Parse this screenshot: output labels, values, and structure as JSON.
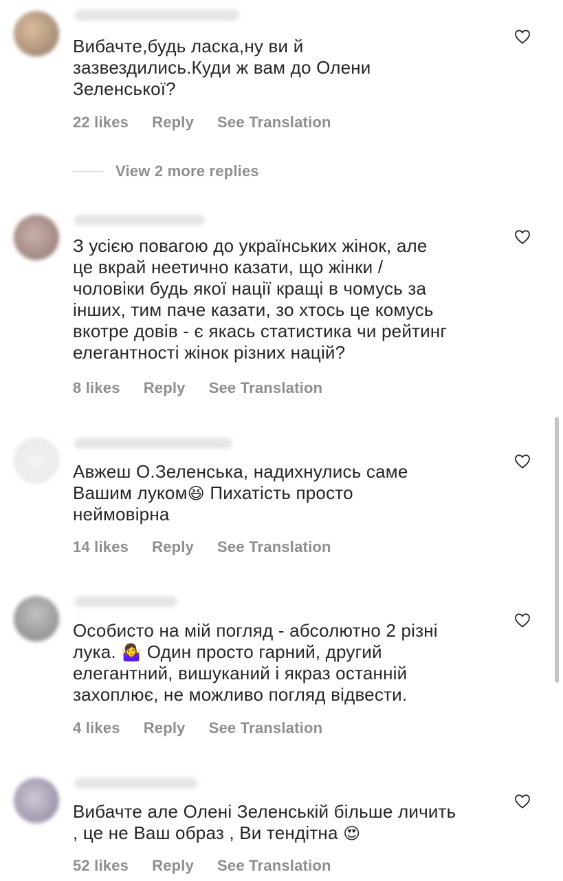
{
  "comments": [
    {
      "text": "Вибачте,будь ласка,ну ви й\nзазвездились.Куди ж вам до Олени\nЗеленської?",
      "likes": "22 likes",
      "reply": "Reply",
      "translate": "See Translation",
      "avatar_color": "#b7916b"
    },
    {
      "text": "З усією повагою до українських жінок, але\nце вкрай неетично казати, що жінки /\nчоловіки будь якої нації кращі в чомусь за\nінших, тим паче казати, зо хтось це комусь\nвкотре довів - є якась статистика чи рейтинг\nелегантності жінок різних націй?",
      "likes": "8 likes",
      "reply": "Reply",
      "translate": "See Translation",
      "avatar_color": "#a98a85"
    },
    {
      "text_before_emoji": "Авжеш О.Зеленська, надихнулись саме\nВашим луком",
      "emoji": "😆",
      "text_after_emoji": " Пихатість просто\nнеймовірна",
      "likes": "14 likes",
      "reply": "Reply",
      "translate": "See Translation",
      "avatar_color": "#ededed"
    },
    {
      "text_before_emoji": "Особисто на мій погляд - абсолютно 2 різні\nлука. ",
      "emoji": "🤷‍♀️",
      "text_after_emoji": " Один просто гарний, другий\nелегантний, вишуканий і якраз останній\nзахоплює, не можливо погляд відвести.",
      "likes": "4 likes",
      "reply": "Reply",
      "translate": "See Translation",
      "avatar_color": "#9a9a9a"
    },
    {
      "text_before_emoji": "Вибачте але Олені Зеленській більше личить\n, це не Ваш образ , Ви тендітна ",
      "emoji": "😍",
      "text_after_emoji": "",
      "likes": "52 likes",
      "reply": "Reply",
      "translate": "See Translation",
      "avatar_color": "#9c93a8"
    }
  ],
  "view_replies": "View 2 more replies",
  "icons": {
    "like": "heart-outline-icon"
  }
}
